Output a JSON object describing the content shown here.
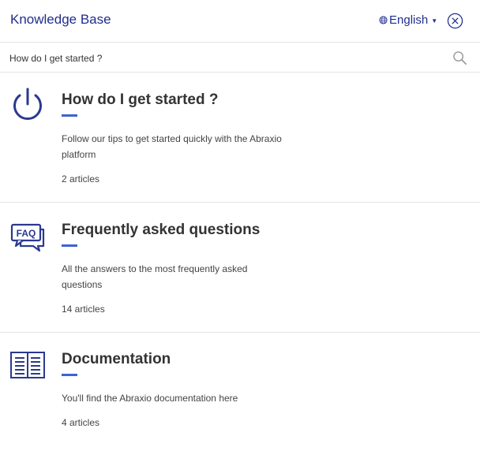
{
  "header": {
    "title": "Knowledge Base",
    "language": "English"
  },
  "search": {
    "value": "How do I get started ?"
  },
  "categories": [
    {
      "icon": "power-icon",
      "title": "How do I get started ?",
      "description": "Follow our tips to get started quickly with the Abraxio platform",
      "count": "2 articles"
    },
    {
      "icon": "faq-icon",
      "title": "Frequently asked questions",
      "description": "All the answers to the most frequently asked questions",
      "count": "14 articles"
    },
    {
      "icon": "book-icon",
      "title": "Documentation",
      "description": "You'll find the Abraxio documentation here",
      "count": "4 articles"
    }
  ],
  "colors": {
    "brand": "#1f2d8f",
    "icon": "#2b3990",
    "accent": "#3b63d6"
  }
}
